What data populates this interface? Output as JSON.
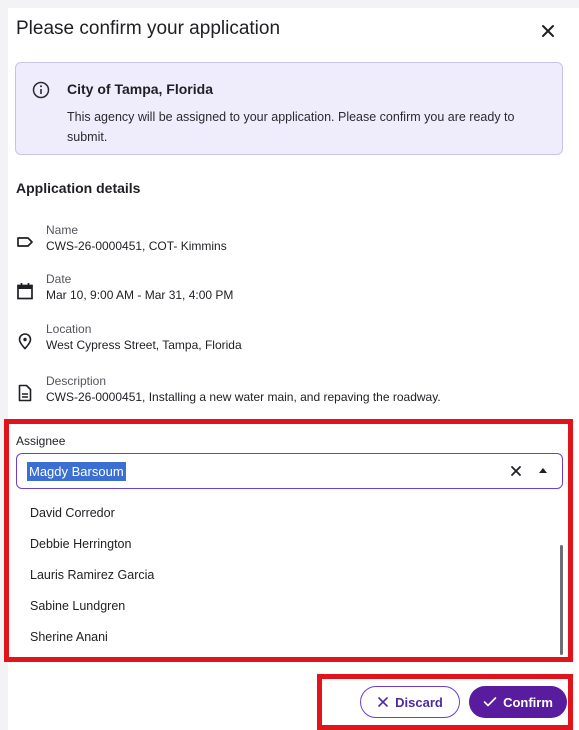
{
  "dialog": {
    "title": "Please confirm your application",
    "close_icon": "close-icon"
  },
  "info": {
    "icon": "info-circle-icon",
    "title": "City of Tampa, Florida",
    "text": "This agency will be assigned to your application. Please confirm you are ready to submit."
  },
  "details": {
    "title": "Application details",
    "items": [
      {
        "icon": "tag-icon",
        "label": "Name",
        "value": "CWS-26-0000451, COT- Kimmins"
      },
      {
        "icon": "calendar-icon",
        "label": "Date",
        "value": "Mar 10, 9:00 AM - Mar 31, 4:00 PM"
      },
      {
        "icon": "location-pin-icon",
        "label": "Location",
        "value": "West Cypress Street, Tampa, Florida"
      },
      {
        "icon": "document-icon",
        "label": "Description",
        "value": "CWS-26-0000451, Installing a new water main, and repaving the roadway."
      }
    ]
  },
  "assignee": {
    "label": "Assignee",
    "value": "Magdy Barsoum",
    "options": [
      "David Corredor",
      "Debbie Herrington",
      "Lauris Ramirez Garcia",
      "Sabine Lundgren",
      "Sherine Anani"
    ]
  },
  "footer": {
    "discard_label": "Discard",
    "confirm_label": "Confirm"
  },
  "colors": {
    "accent": "#5a1c9e",
    "highlight_border": "#e0141a",
    "info_bg": "#efedfb",
    "selection": "#3b6fd1"
  }
}
